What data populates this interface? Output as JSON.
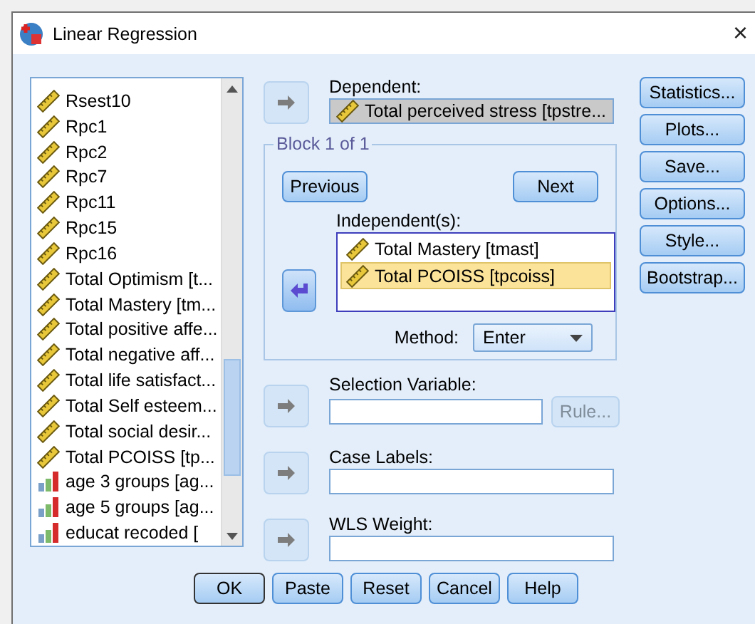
{
  "window": {
    "title": "Linear Regression",
    "close": "×"
  },
  "variables": [
    {
      "name": "Rsest10",
      "kind": "scale"
    },
    {
      "name": "Rpc1",
      "kind": "scale"
    },
    {
      "name": "Rpc2",
      "kind": "scale"
    },
    {
      "name": "Rpc7",
      "kind": "scale"
    },
    {
      "name": "Rpc11",
      "kind": "scale"
    },
    {
      "name": "Rpc15",
      "kind": "scale"
    },
    {
      "name": "Rpc16",
      "kind": "scale"
    },
    {
      "name": "Total Optimism [t...",
      "kind": "scale"
    },
    {
      "name": "Total Mastery [tm...",
      "kind": "scale"
    },
    {
      "name": "Total positive affe...",
      "kind": "scale"
    },
    {
      "name": "Total negative aff...",
      "kind": "scale"
    },
    {
      "name": "Total life satisfact...",
      "kind": "scale"
    },
    {
      "name": "Total Self esteem...",
      "kind": "scale"
    },
    {
      "name": "Total social desir...",
      "kind": "scale"
    },
    {
      "name": "Total PCOISS [tp...",
      "kind": "scale"
    },
    {
      "name": "age 3 groups [ag...",
      "kind": "ordinal"
    },
    {
      "name": "age 5 groups [ag...",
      "kind": "ordinal"
    },
    {
      "name": "educat recoded [",
      "kind": "ordinal"
    }
  ],
  "dependent": {
    "label": "Dependent:",
    "arrow_disabled": true,
    "value": "Total perceived stress [tpstre..."
  },
  "block": {
    "title": "Block 1 of 1",
    "previous": "Previous",
    "next": "Next",
    "label": "Independent(s):",
    "arrow_disabled": false,
    "items": [
      {
        "name": "Total Mastery [tmast]",
        "selected": false
      },
      {
        "name": "Total PCOISS [tpcoiss]",
        "selected": true
      }
    ],
    "method_label": "Method:",
    "method": "Enter"
  },
  "selection": {
    "label": "Selection Variable:",
    "arrow_disabled": true,
    "rule": "Rule...",
    "rule_disabled": true
  },
  "case_labels": {
    "label": "Case Labels:",
    "arrow_disabled": true
  },
  "wls": {
    "label": "WLS Weight:",
    "arrow_disabled": true
  },
  "side_buttons": [
    "Statistics...",
    "Plots...",
    "Save...",
    "Options...",
    "Style...",
    "Bootstrap..."
  ],
  "footer_buttons": [
    {
      "label": "OK",
      "default": true
    },
    {
      "label": "Paste",
      "default": false
    },
    {
      "label": "Reset",
      "default": false
    },
    {
      "label": "Cancel",
      "default": false
    },
    {
      "label": "Help",
      "default": false
    }
  ]
}
